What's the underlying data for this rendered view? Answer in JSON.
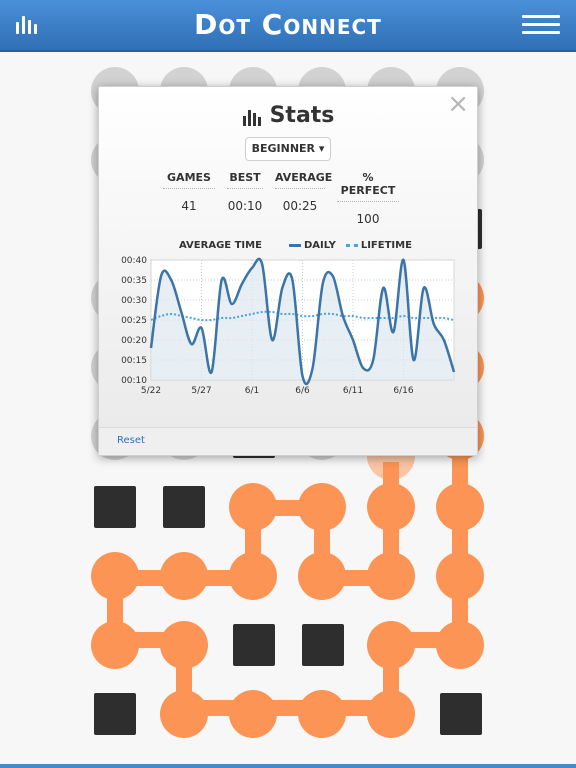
{
  "header": {
    "title": "Dot Connect",
    "stats_icon": "stats-bars-icon",
    "menu_icon": "hamburger-menu-icon"
  },
  "stats_modal": {
    "title": "Stats",
    "title_icon": "stats-bars-icon",
    "close_label": "×",
    "level_select": "BEGINNER ▾",
    "stats": [
      {
        "label": "GAMES",
        "value": "41"
      },
      {
        "label": "BEST",
        "value": "00:10"
      },
      {
        "label": "AVERAGE",
        "value": "00:25"
      },
      {
        "label": "% PERFECT",
        "value": "100"
      }
    ],
    "chart_header": "AVERAGE TIME",
    "reset_label": "Reset"
  },
  "chart_data": {
    "type": "line",
    "title": "AVERAGE TIME",
    "y_ticks": [
      "00:10",
      "00:15",
      "00:20",
      "00:25",
      "00:30",
      "00:35",
      "00:40"
    ],
    "ylim": [
      10,
      40
    ],
    "x_ticks": [
      "5/22",
      "5/27",
      "6/1",
      "6/6",
      "6/11",
      "6/16"
    ],
    "legend_position": "top-right",
    "grid": true,
    "series": [
      {
        "name": "DAILY",
        "style": "solid",
        "color": "#3b74a8",
        "values": [
          18,
          36,
          35,
          27,
          19,
          23,
          12,
          35,
          29,
          34,
          38,
          39,
          20,
          33,
          35,
          11,
          13,
          34,
          36,
          26,
          20,
          13,
          15,
          33,
          22,
          40,
          15,
          33,
          24,
          20,
          12
        ]
      },
      {
        "name": "LIFETIME",
        "style": "dotted",
        "color": "#4aa3df",
        "values": [
          25,
          26,
          26.5,
          26,
          25.5,
          25,
          25,
          25.5,
          25.5,
          26,
          26.5,
          27,
          27,
          26.5,
          26.5,
          26,
          26,
          26.5,
          26.5,
          26,
          26,
          25.5,
          25.5,
          25.5,
          25.5,
          26,
          25.5,
          25.5,
          25.5,
          25.5,
          25
        ]
      }
    ]
  },
  "colors": {
    "accent": "#2f6fb5",
    "dot_orange": "#fb9454",
    "block": "#2e2e2e",
    "dot_gray": "#d2d2d2"
  }
}
